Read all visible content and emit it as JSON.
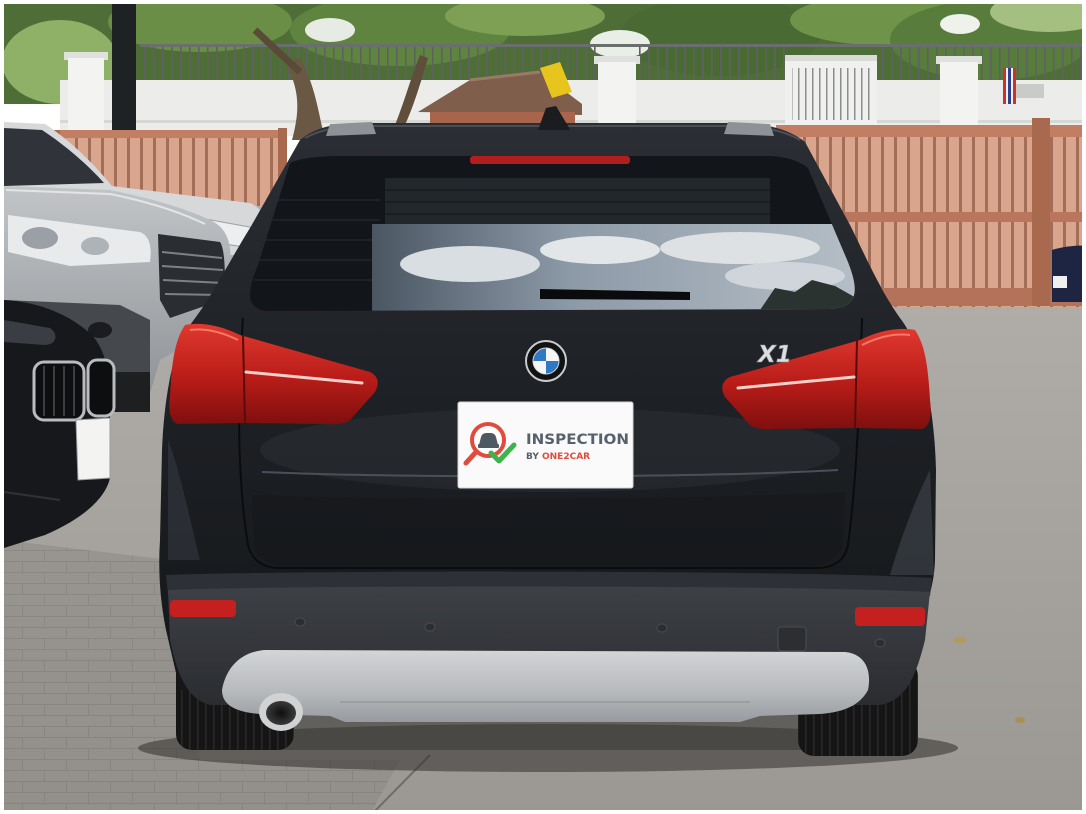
{
  "inspection_badge": {
    "title": "INSPECTION",
    "by_prefix": "BY",
    "brand": "ONE2CAR"
  },
  "vehicle": {
    "model_badge": "X1"
  },
  "colors": {
    "badge_text": "#56616c",
    "brand_red": "#e14b3b",
    "check_green": "#3bb54a",
    "tail_light": "#c3201f",
    "bmw_blue": "#2f78c4"
  }
}
